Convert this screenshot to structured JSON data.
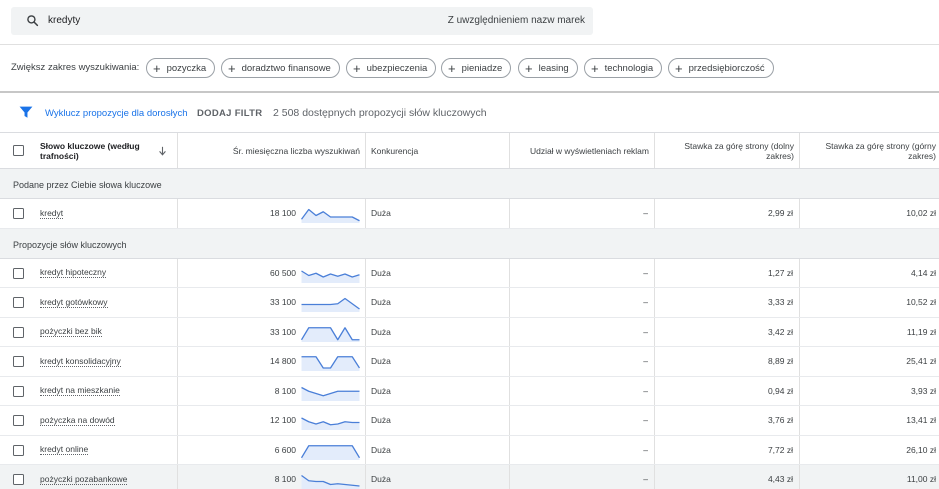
{
  "search": {
    "query": "kredyty",
    "brand_note": "Z uwzględnieniem nazw marek"
  },
  "expand": {
    "label": "Zwiększ zakres wyszukiwania:",
    "chips": [
      "pozyczka",
      "doradztwo finansowe",
      "ubezpieczenia",
      "pieniadze",
      "leasing",
      "technologia",
      "przedsiębiorczość"
    ]
  },
  "filters": {
    "adult_label": "Wyklucz propozycje dla dorosłych",
    "add_filter": "DODAJ FILTR",
    "available": "2 508 dostępnych propozycji słów kluczowych"
  },
  "table": {
    "headers": {
      "keyword": "Słowo kluczowe (według trafności)",
      "avg_searches": "Śr. miesięczna liczba wyszukiwań",
      "competition": "Konkurencja",
      "impr_share": "Udział w wyświetleniach reklam",
      "bid_low": "Stawka za górę strony (dolny zakres)",
      "bid_high": "Stawka za górę strony (górny zakres)"
    },
    "groups": [
      {
        "title": "Podane przez Ciebie słowa kluczowe",
        "rows": [
          {
            "keyword": "kredyt",
            "searches": "18 100",
            "trend": [
              0.85,
              0.2,
              0.6,
              0.35,
              0.7,
              0.7,
              0.7,
              0.7,
              0.95
            ],
            "competition": "Duża",
            "share": "–",
            "low": "2,99 zł",
            "high": "10,02 zł"
          }
        ]
      },
      {
        "title": "Propozycje słów kluczowych",
        "rows": [
          {
            "keyword": "kredyt hipoteczny",
            "searches": "60 500",
            "trend": [
              0.3,
              0.6,
              0.45,
              0.7,
              0.5,
              0.65,
              0.5,
              0.7,
              0.55
            ],
            "competition": "Duża",
            "share": "–",
            "low": "1,27 zł",
            "high": "4,14 zł"
          },
          {
            "keyword": "kredyt gotówkowy",
            "searches": "33 100",
            "trend": [
              0.6,
              0.6,
              0.6,
              0.6,
              0.6,
              0.55,
              0.2,
              0.55,
              0.9
            ],
            "competition": "Duża",
            "share": "–",
            "low": "3,33 zł",
            "high": "10,52 zł"
          },
          {
            "keyword": "pożyczki bez bik",
            "searches": "33 100",
            "trend": [
              0.95,
              0.15,
              0.15,
              0.15,
              0.15,
              0.95,
              0.15,
              0.95,
              0.95
            ],
            "competition": "Duża",
            "share": "–",
            "low": "3,42 zł",
            "high": "11,19 zł"
          },
          {
            "keyword": "kredyt konsolidacyjny",
            "searches": "14 800",
            "trend": [
              0.15,
              0.15,
              0.15,
              0.9,
              0.9,
              0.15,
              0.15,
              0.15,
              0.9
            ],
            "competition": "Duża",
            "share": "–",
            "low": "8,89 zł",
            "high": "25,41 zł"
          },
          {
            "keyword": "kredyt na mieszkanie",
            "searches": "8 100",
            "trend": [
              0.2,
              0.45,
              0.6,
              0.75,
              0.6,
              0.45,
              0.45,
              0.45,
              0.45
            ],
            "competition": "Duża",
            "share": "–",
            "low": "0,94 zł",
            "high": "3,93 zł"
          },
          {
            "keyword": "pożyczka na dowód",
            "searches": "12 100",
            "trend": [
              0.3,
              0.55,
              0.7,
              0.55,
              0.75,
              0.7,
              0.55,
              0.6,
              0.6
            ],
            "competition": "Duża",
            "share": "–",
            "low": "3,76 zł",
            "high": "13,41 zł"
          },
          {
            "keyword": "kredyt online",
            "searches": "6 600",
            "trend": [
              0.95,
              0.15,
              0.15,
              0.15,
              0.15,
              0.15,
              0.15,
              0.15,
              0.95
            ],
            "competition": "Duża",
            "share": "–",
            "low": "7,72 zł",
            "high": "26,10 zł"
          },
          {
            "keyword": "pożyczki pozabankowe",
            "searches": "8 100",
            "trend": [
              0.2,
              0.55,
              0.6,
              0.6,
              0.8,
              0.75,
              0.8,
              0.85,
              0.9
            ],
            "competition": "Duża",
            "share": "–",
            "low": "4,43 zł",
            "high": "11,00 zł"
          }
        ]
      }
    ]
  },
  "colors": {
    "accent": "#1a73e8",
    "sparkline": "#4a7fd8",
    "sparkline_fill": "#e3ecfb",
    "group_bg": "#f1f3f4"
  }
}
